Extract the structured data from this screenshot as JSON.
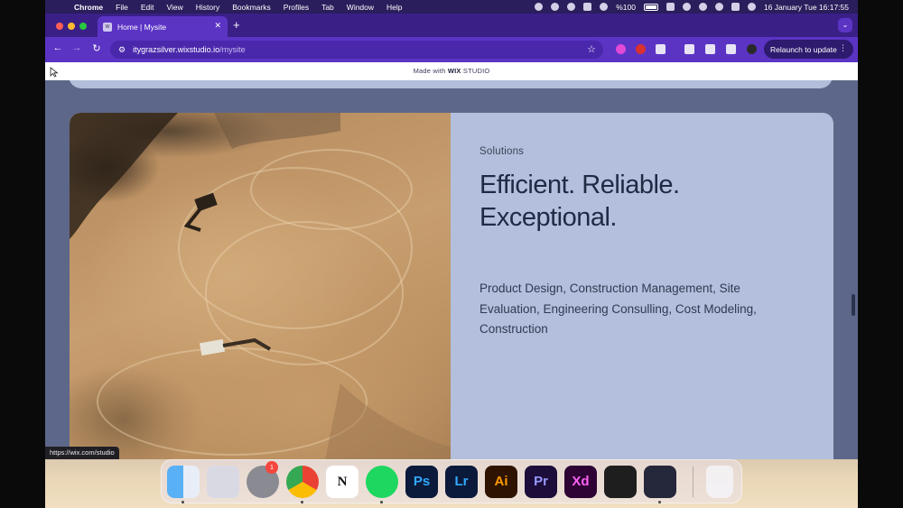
{
  "menubar": {
    "apple_icon": "apple-icon",
    "app_name": "Chrome",
    "items": [
      "File",
      "Edit",
      "View",
      "History",
      "Bookmarks",
      "Profiles",
      "Tab",
      "Window",
      "Help"
    ],
    "battery": "%100",
    "datetime": "16 January Tue  16:17:55"
  },
  "browser": {
    "tab_title": "Home | Mysite",
    "url_host": "itygrazsilver.wixstudio.io",
    "url_path": "/mysite",
    "relaunch_label": "Relaunch to update",
    "status_url": "https://wix.com/studio"
  },
  "page": {
    "wix_banner_prefix": "Made with ",
    "wix_banner_brand": "WIX",
    "wix_banner_suffix": " STUDIO",
    "eyebrow": "Solutions",
    "headline_line1": "Efficient. Reliable.",
    "headline_line2": "Exceptional.",
    "description": "Product Design, Construction Management, Site Evaluation, Engineering Consulling, Cost Modeling, Construction"
  },
  "dock": {
    "apps": [
      {
        "name": "Finder",
        "label": ""
      },
      {
        "name": "Launchpad",
        "label": ""
      },
      {
        "name": "System Settings",
        "label": ""
      },
      {
        "name": "Chrome",
        "label": ""
      },
      {
        "name": "Notion",
        "label": "N"
      },
      {
        "name": "Spotify",
        "label": ""
      },
      {
        "name": "Photoshop",
        "label": "Ps"
      },
      {
        "name": "Lightroom",
        "label": "Lr"
      },
      {
        "name": "Illustrator",
        "label": "Ai"
      },
      {
        "name": "Premiere Pro",
        "label": "Pr"
      },
      {
        "name": "Adobe XD",
        "label": "Xd"
      },
      {
        "name": "Figma",
        "label": ""
      },
      {
        "name": "OBS",
        "label": ""
      },
      {
        "name": "Trash",
        "label": ""
      }
    ],
    "settings_badge": "1"
  },
  "colors": {
    "tabstrip": "#3a1f87",
    "toolbar": "#5b34c4",
    "card": "#b3bfdc",
    "page_bg": "#5d6789"
  }
}
